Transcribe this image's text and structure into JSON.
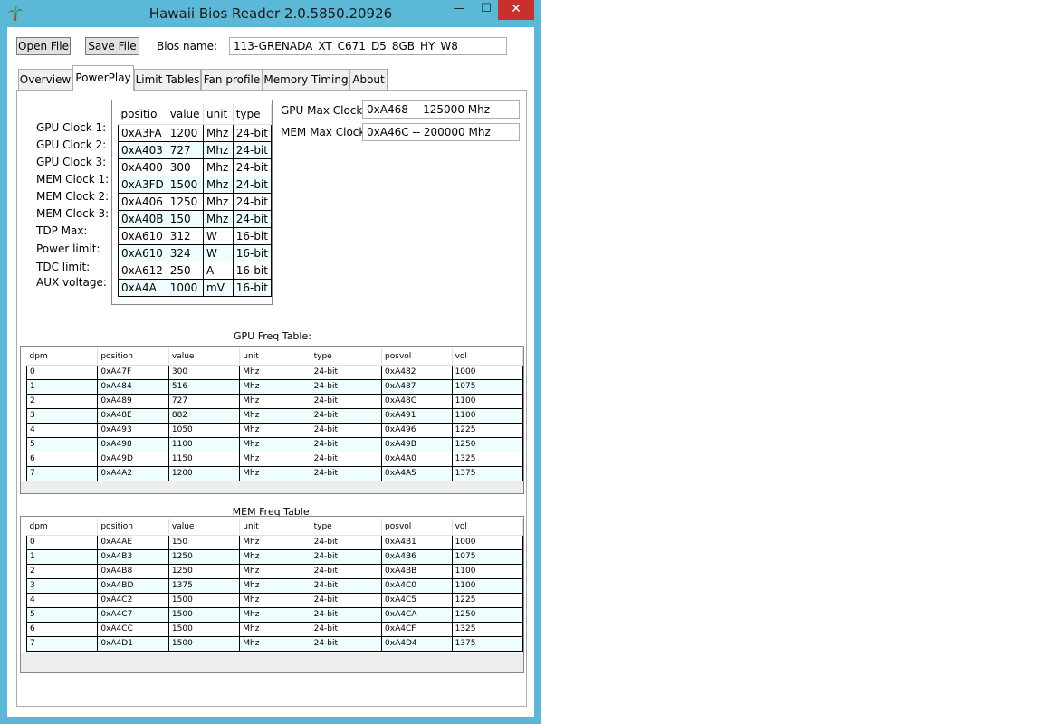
{
  "window": {
    "title": "Hawaii Bios Reader 2.0.5850.20926",
    "min": "—",
    "max": "☐",
    "close": "✕"
  },
  "toolbar": {
    "open_label": "Open File",
    "save_label": "Save File",
    "bios_name_label": "Bios name:",
    "bios_name_value": "113-GRENADA_XT_C671_D5_8GB_HY_W8"
  },
  "tabs": [
    "Overview",
    "PowerPlay",
    "Limit Tables",
    "Fan profile",
    "Memory Timing",
    "About"
  ],
  "powerplay": {
    "row_labels": [
      "GPU Clock 1:",
      "GPU Clock 2:",
      "GPU Clock 3:",
      "MEM Clock 1:",
      "MEM Clock 2:",
      "MEM Clock 3:",
      "TDP Max:",
      "Power limit:",
      "TDC limit:",
      "AUX voltage:"
    ],
    "columns": [
      "positio",
      "value",
      "unit",
      "type"
    ],
    "rows": [
      [
        "0xA3FA",
        "1200",
        "Mhz",
        "24-bit"
      ],
      [
        "0xA403",
        "727",
        "Mhz",
        "24-bit"
      ],
      [
        "0xA400",
        "300",
        "Mhz",
        "24-bit"
      ],
      [
        "0xA3FD",
        "1500",
        "Mhz",
        "24-bit"
      ],
      [
        "0xA406",
        "1250",
        "Mhz",
        "24-bit"
      ],
      [
        "0xA40B",
        "150",
        "Mhz",
        "24-bit"
      ],
      [
        "0xA610",
        "312",
        "W",
        "16-bit"
      ],
      [
        "0xA610",
        "324",
        "W",
        "16-bit"
      ],
      [
        "0xA612",
        "250",
        "A",
        "16-bit"
      ],
      [
        "0xA4A",
        "1000",
        "mV",
        "16-bit"
      ]
    ],
    "gpu_max_label": "GPU Max Clock:",
    "gpu_max_value": "0xA468 -- 125000 Mhz",
    "mem_max_label": "MEM Max Clock:",
    "mem_max_value": "0xA46C -- 200000 Mhz"
  },
  "gpu_freq": {
    "title": "GPU Freq Table:",
    "columns": [
      "dpm",
      "position",
      "value",
      "unit",
      "type",
      "posvol",
      "vol"
    ],
    "rows": [
      [
        "0",
        "0xA47F",
        "300",
        "Mhz",
        "24-bit",
        "0xA482",
        "1000"
      ],
      [
        "1",
        "0xA484",
        "516",
        "Mhz",
        "24-bit",
        "0xA487",
        "1075"
      ],
      [
        "2",
        "0xA489",
        "727",
        "Mhz",
        "24-bit",
        "0xA48C",
        "1100"
      ],
      [
        "3",
        "0xA48E",
        "882",
        "Mhz",
        "24-bit",
        "0xA491",
        "1100"
      ],
      [
        "4",
        "0xA493",
        "1050",
        "Mhz",
        "24-bit",
        "0xA496",
        "1225"
      ],
      [
        "5",
        "0xA498",
        "1100",
        "Mhz",
        "24-bit",
        "0xA49B",
        "1250"
      ],
      [
        "6",
        "0xA49D",
        "1150",
        "Mhz",
        "24-bit",
        "0xA4A0",
        "1325"
      ],
      [
        "7",
        "0xA4A2",
        "1200",
        "Mhz",
        "24-bit",
        "0xA4A5",
        "1375"
      ]
    ]
  },
  "mem_freq": {
    "title": "MEM Freq Table:",
    "columns": [
      "dpm",
      "position",
      "value",
      "unit",
      "type",
      "posvol",
      "vol"
    ],
    "rows": [
      [
        "0",
        "0xA4AE",
        "150",
        "Mhz",
        "24-bit",
        "0xA4B1",
        "1000"
      ],
      [
        "1",
        "0xA4B3",
        "1250",
        "Mhz",
        "24-bit",
        "0xA4B6",
        "1075"
      ],
      [
        "2",
        "0xA4B8",
        "1250",
        "Mhz",
        "24-bit",
        "0xA4BB",
        "1100"
      ],
      [
        "3",
        "0xA4BD",
        "1375",
        "Mhz",
        "24-bit",
        "0xA4C0",
        "1100"
      ],
      [
        "4",
        "0xA4C2",
        "1500",
        "Mhz",
        "24-bit",
        "0xA4C5",
        "1225"
      ],
      [
        "5",
        "0xA4C7",
        "1500",
        "Mhz",
        "24-bit",
        "0xA4CA",
        "1250"
      ],
      [
        "6",
        "0xA4CC",
        "1500",
        "Mhz",
        "24-bit",
        "0xA4CF",
        "1325"
      ],
      [
        "7",
        "0xA4D1",
        "1500",
        "Mhz",
        "24-bit",
        "0xA4D4",
        "1375"
      ]
    ]
  }
}
